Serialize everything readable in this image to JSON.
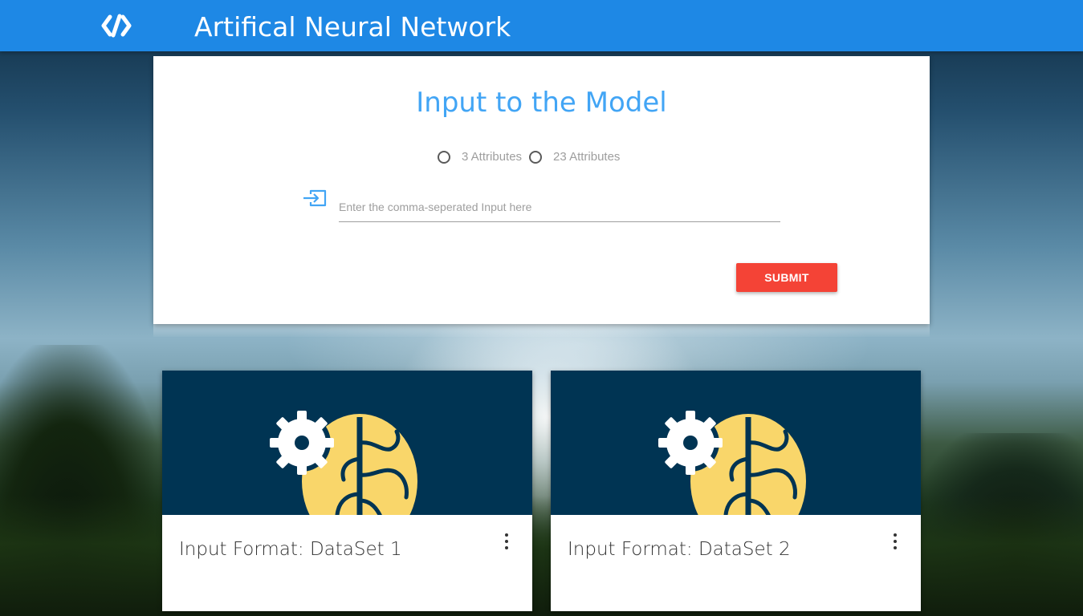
{
  "header": {
    "logo_icon": "code-brackets-icon",
    "title": "Artifical Neural Network",
    "color": "#1e88e5"
  },
  "input_card": {
    "heading": "Input to the Model",
    "radio_options": [
      {
        "label": "3 Attributes",
        "selected": false
      },
      {
        "label": "23 Attributes",
        "selected": false
      }
    ],
    "input_icon": "input-arrow-icon",
    "input_placeholder": "Enter the comma-seperated Input here",
    "input_value": "",
    "submit_label": "SUBMIT",
    "submit_color": "#f44336",
    "heading_color": "#42a5f5"
  },
  "dataset_cards": [
    {
      "title": "Input Format: DataSet 1",
      "image_icon": "brain-gear-icon",
      "menu_icon": "more-vert-icon"
    },
    {
      "title": "Input Format: DataSet 2",
      "image_icon": "brain-gear-icon",
      "menu_icon": "more-vert-icon"
    }
  ]
}
